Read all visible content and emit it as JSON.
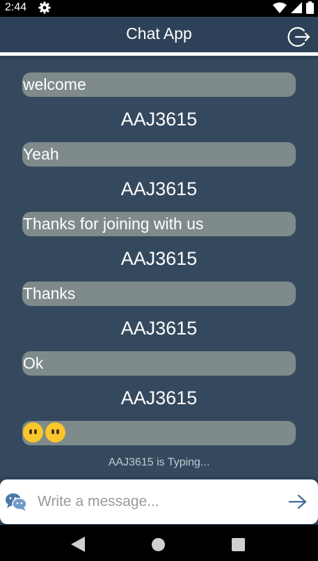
{
  "status_bar": {
    "time": "2:44",
    "icons": [
      "gear-icon",
      "wifi-icon",
      "signal-icon",
      "battery-icon"
    ]
  },
  "app_bar": {
    "title": "Chat App",
    "logout_icon": "logout-icon"
  },
  "messages": [
    {
      "text": "welcome",
      "sender": "AAJ3615"
    },
    {
      "text": "Yeah",
      "sender": "AAJ3615"
    },
    {
      "text": "Thanks for joining with us",
      "sender": "AAJ3615"
    },
    {
      "text": "Thanks",
      "sender": "AAJ3615"
    },
    {
      "text": "Ok",
      "sender": "AAJ3615"
    },
    {
      "text": "",
      "emoji": [
        "neutral-face-emoji",
        "neutral-face-emoji"
      ]
    }
  ],
  "typing_indicator": "AAJ3615 is Typing...",
  "composer": {
    "placeholder": "Write a message...",
    "value": "",
    "left_icon": "chat-bubbles-icon",
    "send_icon": "arrow-right-icon"
  },
  "colors": {
    "background": "#2d4258",
    "chat_area": "#35495e",
    "bubble": "#7f8a8b",
    "accent": "#3f6a9a"
  }
}
